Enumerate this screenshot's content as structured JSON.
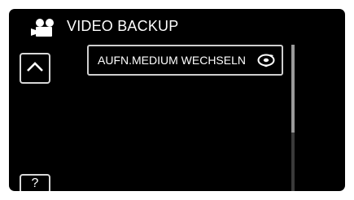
{
  "header": {
    "title": "VIDEO BACKUP",
    "icon": "video-camera-icon"
  },
  "sidebar": {
    "up_icon": "chevron-up-icon",
    "help_label": "?"
  },
  "menu": {
    "items": [
      {
        "label": "AUFN.MEDIUM WECHSELN",
        "icon": "disc-swap-icon"
      }
    ]
  },
  "scrollbar": {
    "position": 0,
    "visible_fraction": 0.6
  },
  "colors": {
    "background": "#000000",
    "frame": "#ffffff",
    "border": "#cfcfcf",
    "text": "#ffffff"
  }
}
